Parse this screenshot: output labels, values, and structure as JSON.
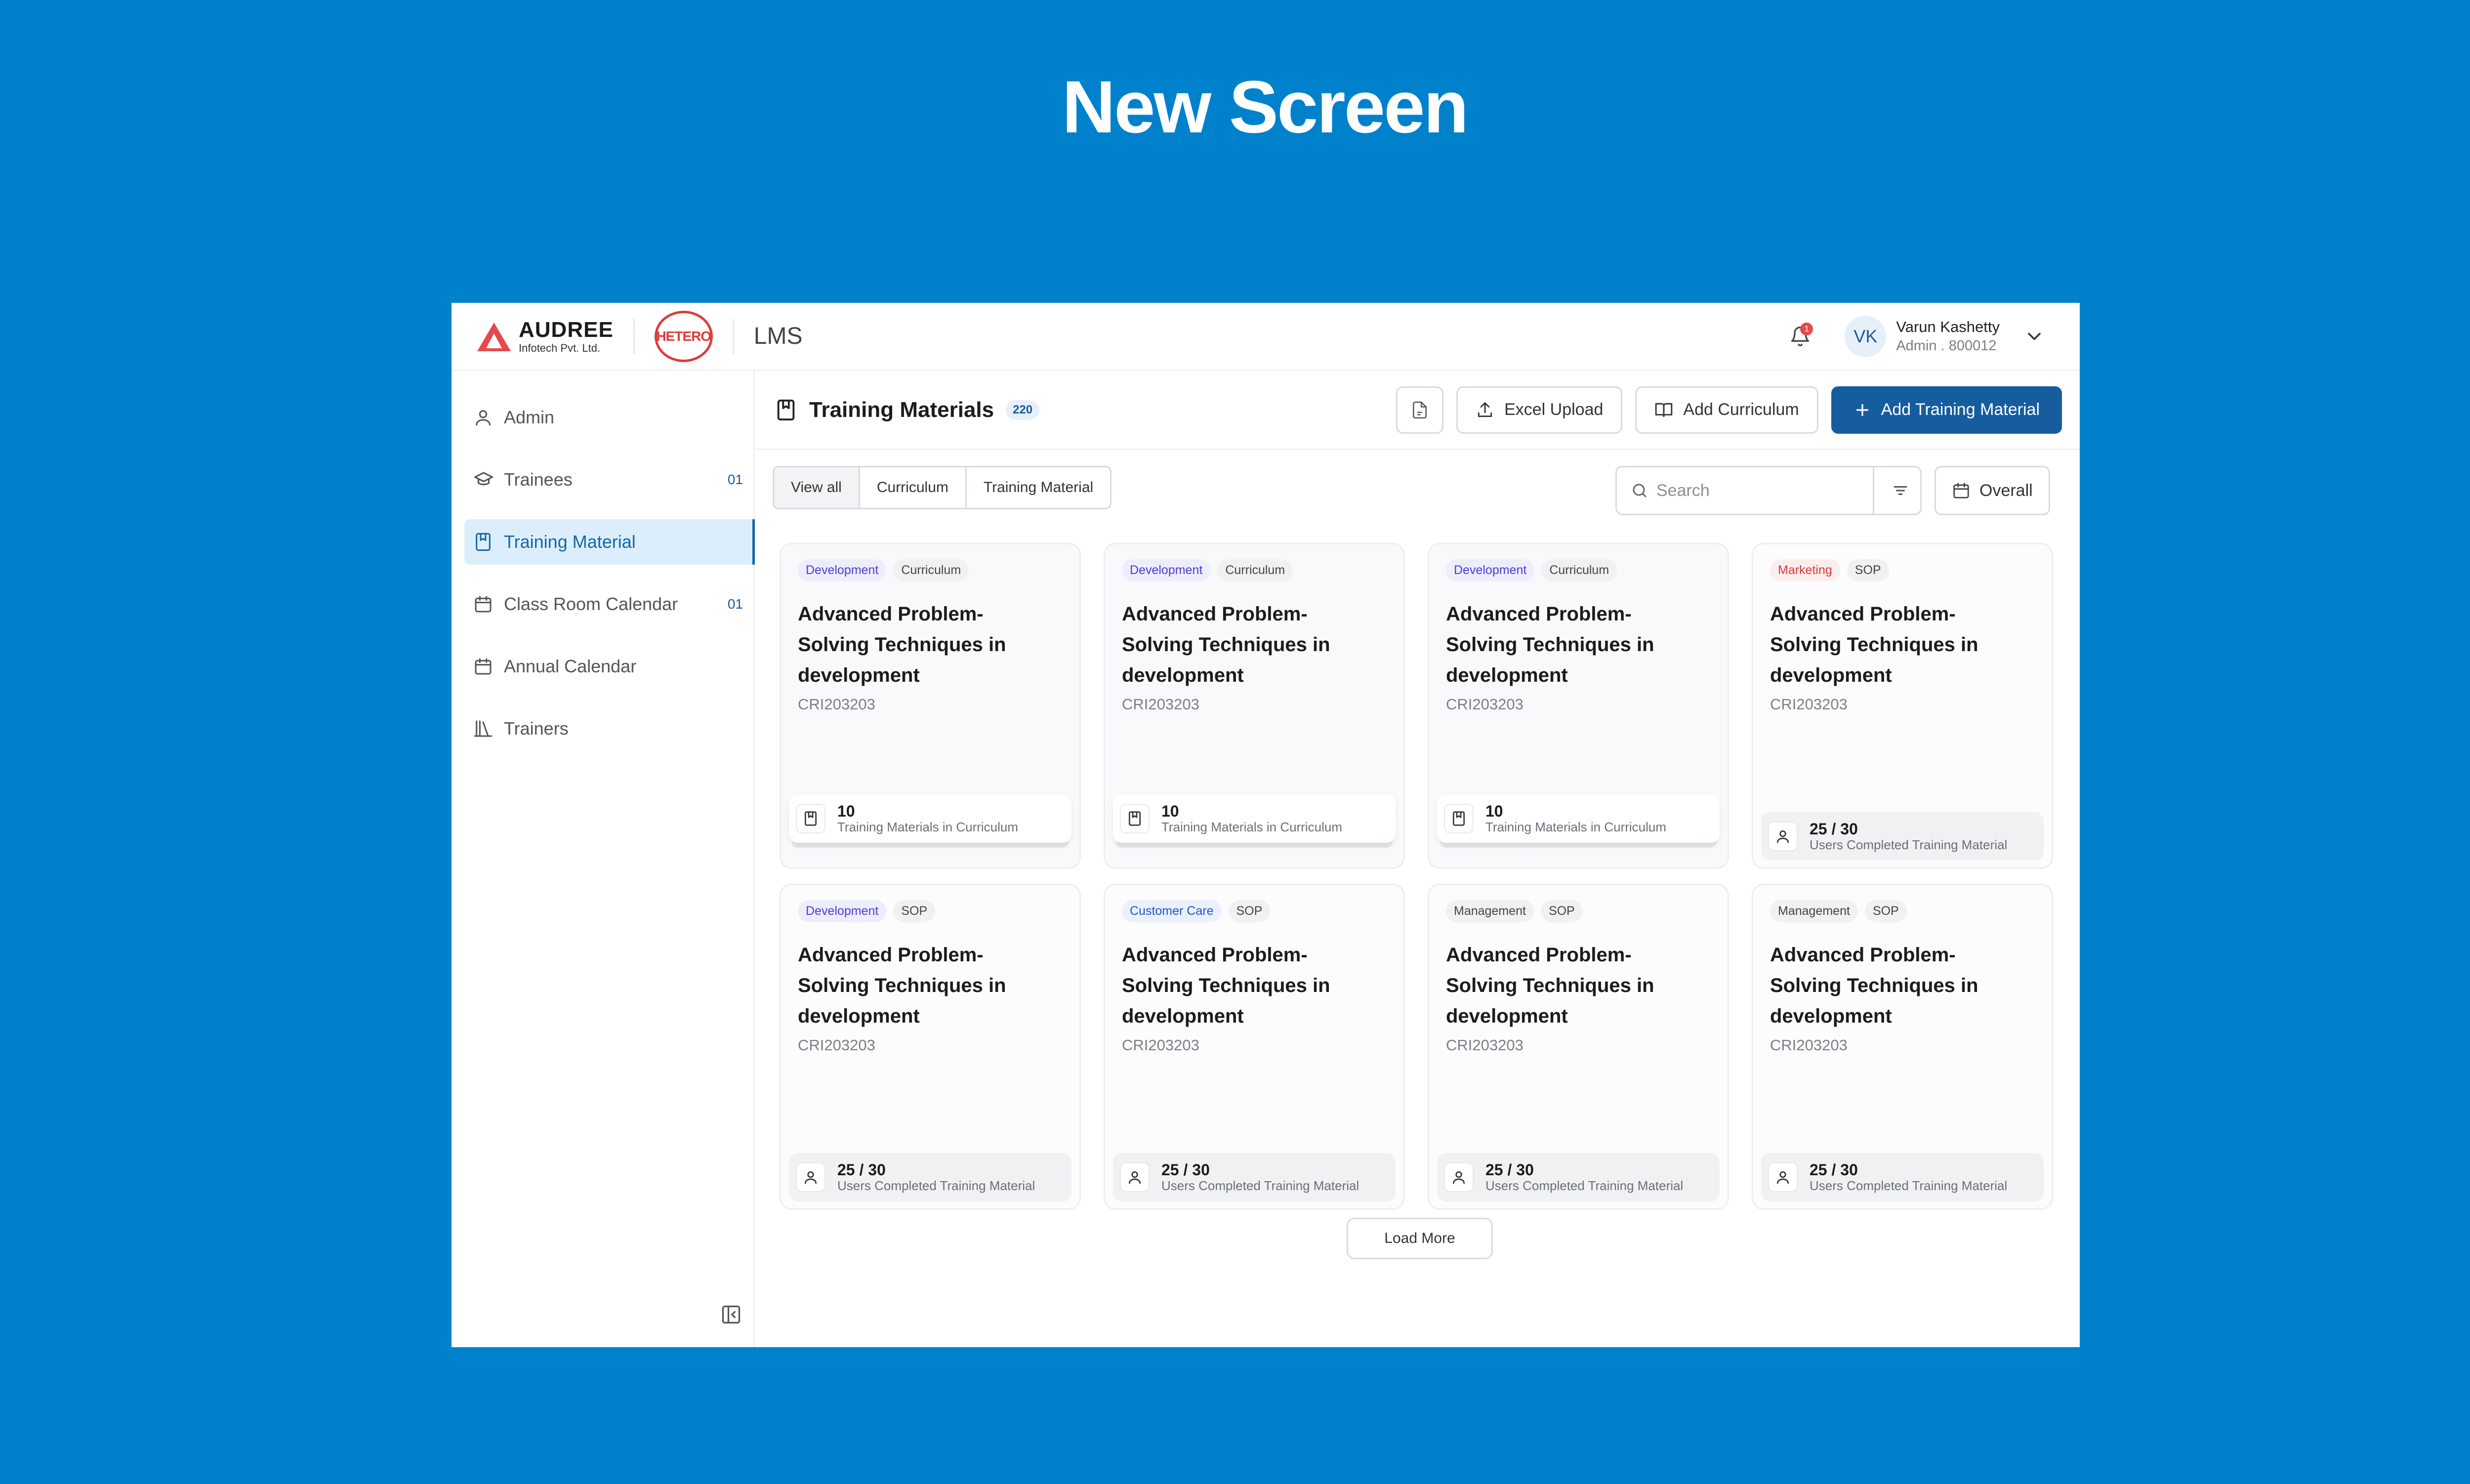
{
  "banner": {
    "title": "New Screen"
  },
  "header": {
    "brand_name": "AUDREE",
    "brand_sub": "Infotech Pvt. Ltd.",
    "partner_logo": "HETERO",
    "app_name": "LMS",
    "notification_count": "1",
    "user": {
      "initials": "VK",
      "name": "Varun Kashetty",
      "role": "Admin . 800012"
    }
  },
  "sidebar": {
    "items": [
      {
        "label": "Admin",
        "icon": "user-icon",
        "count": ""
      },
      {
        "label": "Trainees",
        "icon": "graduation-cap-icon",
        "count": "01"
      },
      {
        "label": "Training Material",
        "icon": "bookmark-book-icon",
        "count": "",
        "active": true
      },
      {
        "label": "Class Room Calendar",
        "icon": "calendar-icon",
        "count": "01"
      },
      {
        "label": "Annual Calendar",
        "icon": "calendar-icon",
        "count": ""
      },
      {
        "label": "Trainers",
        "icon": "library-icon",
        "count": ""
      }
    ]
  },
  "page": {
    "title": "Training Materials",
    "count": "220",
    "actions": {
      "excel_upload": "Excel Upload",
      "add_curriculum": "Add Curriculum",
      "add_material": "Add Training Material"
    },
    "filters": {
      "view_all": "View all",
      "curriculum": "Curriculum",
      "training_material": "Training Material"
    },
    "search_placeholder": "Search",
    "date_filter": "Overall",
    "load_more": "Load More"
  },
  "cards": [
    {
      "tags": [
        "Development",
        "Curriculum"
      ],
      "title": "Advanced Problem-Solving Techniques in development",
      "code": "CRI203203",
      "footer_type": "curriculum",
      "footer_value": "10",
      "footer_label": "Training Materials in Curriculum"
    },
    {
      "tags": [
        "Development",
        "Curriculum"
      ],
      "title": "Advanced Problem-Solving Techniques in development",
      "code": "CRI203203",
      "footer_type": "curriculum",
      "footer_value": "10",
      "footer_label": "Training Materials in Curriculum"
    },
    {
      "tags": [
        "Development",
        "Curriculum"
      ],
      "title": "Advanced Problem-Solving Techniques in development",
      "code": "CRI203203",
      "footer_type": "curriculum",
      "footer_value": "10",
      "footer_label": "Training Materials in Curriculum"
    },
    {
      "tags": [
        "Marketing",
        "SOP"
      ],
      "title": "Advanced Problem-Solving Techniques in development",
      "code": "CRI203203",
      "footer_type": "users",
      "footer_value": "25 / 30",
      "footer_label": "Users Completed Training Material"
    },
    {
      "tags": [
        "Development",
        "SOP"
      ],
      "title": "Advanced Problem-Solving Techniques in development",
      "code": "CRI203203",
      "footer_type": "users",
      "footer_value": "25 / 30",
      "footer_label": "Users Completed Training Material"
    },
    {
      "tags": [
        "Customer Care",
        "SOP"
      ],
      "title": "Advanced Problem-Solving Techniques in development",
      "code": "CRI203203",
      "footer_type": "users",
      "footer_value": "25 / 30",
      "footer_label": "Users Completed Training Material"
    },
    {
      "tags": [
        "Management",
        "SOP"
      ],
      "title": "Advanced Problem-Solving Techniques in development",
      "code": "CRI203203",
      "footer_type": "users",
      "footer_value": "25 / 30",
      "footer_label": "Users Completed Training Material"
    },
    {
      "tags": [
        "Management",
        "SOP"
      ],
      "title": "Advanced Problem-Solving Techniques in development",
      "code": "CRI203203",
      "footer_type": "users",
      "footer_value": "25 / 30",
      "footer_label": "Users Completed Training Material"
    }
  ],
  "colors": {
    "background": "#0081CC",
    "primary": "#155D9E",
    "active_nav_bg": "#DCEEFB",
    "development_tag": "#4A3FD6",
    "marketing_tag": "#D93A3A",
    "customer_care_tag": "#1E56C8"
  }
}
